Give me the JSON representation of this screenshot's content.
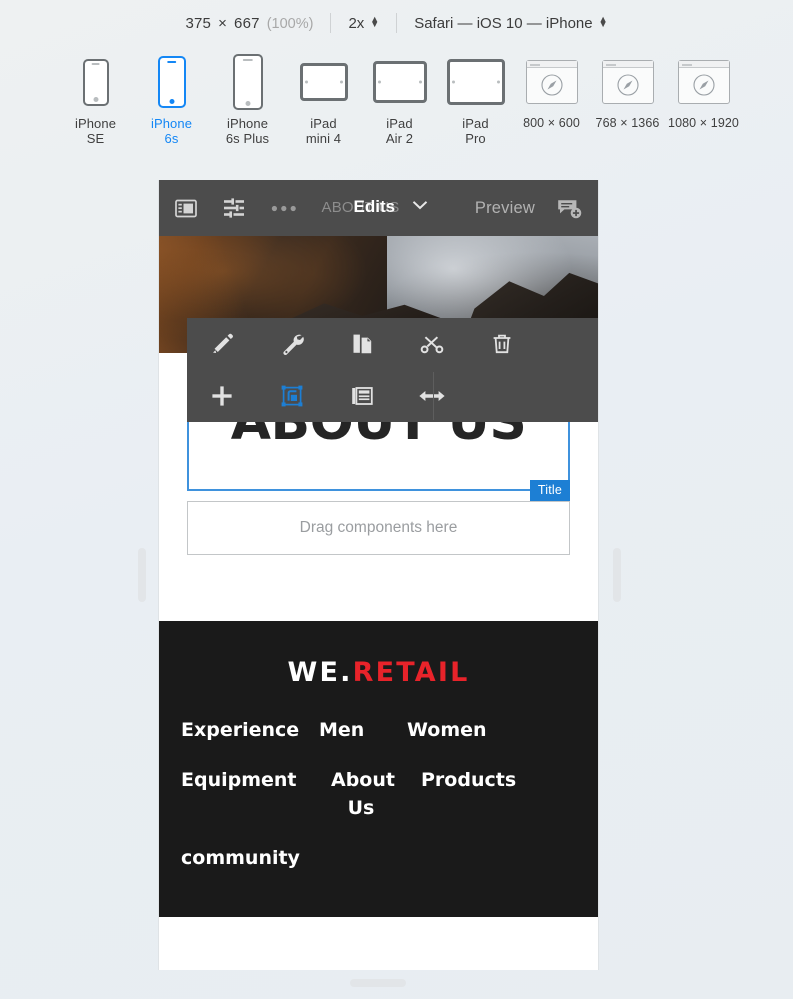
{
  "device_bar": {
    "width": "375",
    "times": "×",
    "height": "667",
    "zoom_percent": "(100%)",
    "scale": "2x",
    "browser": "Safari — iOS 10 — iPhone"
  },
  "devices": [
    {
      "label_line1": "iPhone",
      "label_line2": "SE",
      "type": "phone",
      "selected": false
    },
    {
      "label_line1": "iPhone",
      "label_line2": "6s",
      "type": "phone",
      "selected": true
    },
    {
      "label_line1": "iPhone",
      "label_line2": "6s Plus",
      "type": "phone",
      "selected": false
    },
    {
      "label_line1": "iPad",
      "label_line2": "mini 4",
      "type": "tablet",
      "selected": false
    },
    {
      "label_line1": "iPad",
      "label_line2": "Air 2",
      "type": "tablet",
      "selected": false
    },
    {
      "label_line1": "iPad",
      "label_line2": "Pro",
      "type": "tablet",
      "selected": false
    },
    {
      "label_line1": "800 × 600",
      "label_line2": "",
      "type": "browser",
      "selected": false
    },
    {
      "label_line1": "768 × 1366",
      "label_line2": "",
      "type": "browser",
      "selected": false
    },
    {
      "label_line1": "1080 × 1920",
      "label_line2": "",
      "type": "browser",
      "selected": false
    }
  ],
  "app_toolbar": {
    "sidebar_icon": "sidebar-panel-icon",
    "settings_icon": "sliders-icon",
    "more_icon": "ellipsis-icon",
    "page_name": "ABOUT US",
    "mode_label": "Edits",
    "chevron_icon": "chevron-down-icon",
    "preview_label": "Preview",
    "annotate_icon": "add-comment-icon"
  },
  "context_toolbar": {
    "row1": [
      {
        "name": "edit-pencil",
        "icon": "pencil-icon",
        "active": false
      },
      {
        "name": "configure",
        "icon": "wrench-icon",
        "active": false
      },
      {
        "name": "copy",
        "icon": "copy-icon",
        "active": false
      },
      {
        "name": "cut",
        "icon": "scissors-icon",
        "active": false
      },
      {
        "name": "delete",
        "icon": "trash-icon",
        "active": false
      }
    ],
    "row2": [
      {
        "name": "insert",
        "icon": "plus-icon",
        "active": false
      },
      {
        "name": "select-parent",
        "icon": "select-parent-icon",
        "active": true
      },
      {
        "name": "layout",
        "icon": "layout-icon",
        "active": false
      },
      {
        "name": "resize-horizontal",
        "icon": "arrows-horizontal-icon",
        "active": false
      }
    ]
  },
  "content": {
    "title_text": "ABOUT US",
    "title_badge": "Title",
    "drop_placeholder": "Drag components here"
  },
  "footer": {
    "brand_white": "WE.",
    "brand_red": "RETAIL",
    "links": [
      "Experience",
      "Men",
      "Women",
      "Equipment",
      "About Us",
      "Products",
      "community"
    ]
  },
  "colors": {
    "accent_blue": "#1487f5",
    "selection_blue": "#3f92dd",
    "badge_blue": "#1d7fd4",
    "brand_red": "#e8232a",
    "toolbar_gray": "#4c4c4c",
    "footer_black": "#1a1a1a"
  }
}
